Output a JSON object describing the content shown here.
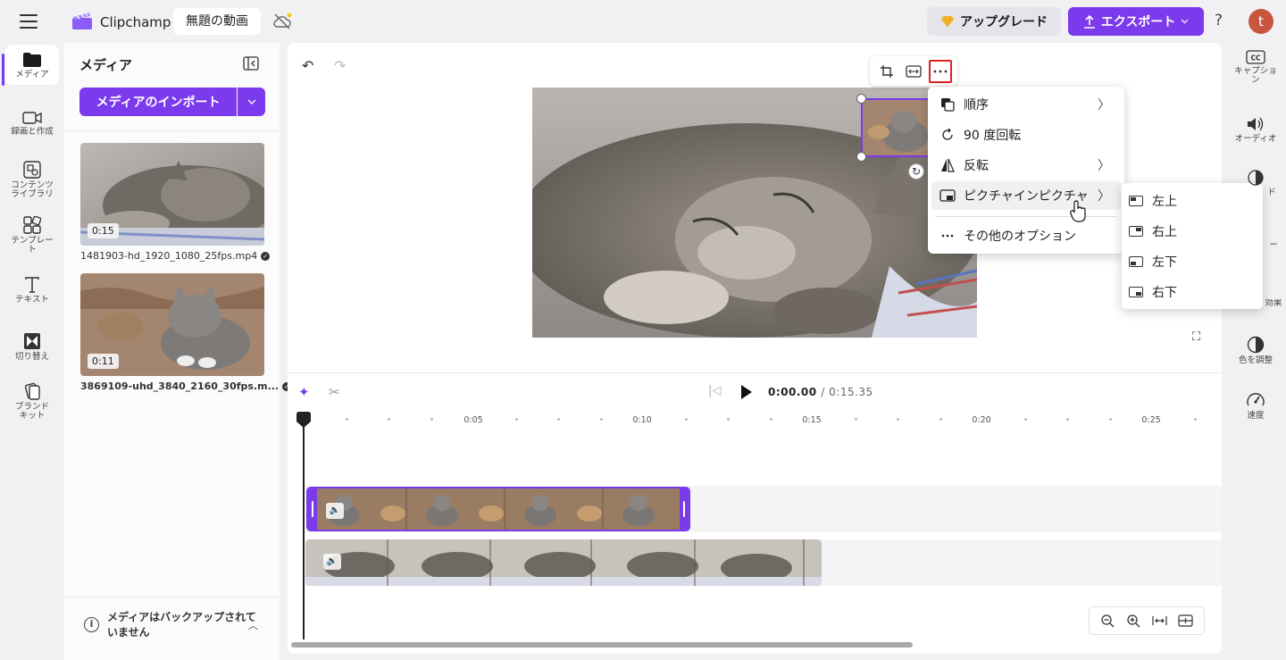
{
  "header": {
    "app_name": "Clipchamp",
    "project_title": "無題の動画",
    "upgrade_label": "アップグレード",
    "export_label": "エクスポート",
    "help_label": "?",
    "avatar_initial": "t"
  },
  "left_rail": {
    "items": [
      {
        "label": "メディア",
        "icon": "folder-icon"
      },
      {
        "label": "録画と作成",
        "icon": "video-camera-icon"
      },
      {
        "label": "コンテンツ ライブラリ",
        "icon": "library-icon"
      },
      {
        "label": "テンプレート",
        "icon": "template-icon"
      },
      {
        "label": "テキスト",
        "icon": "text-icon"
      },
      {
        "label": "切り替え",
        "icon": "transition-icon"
      },
      {
        "label": "ブランド キット",
        "icon": "brand-kit-icon"
      }
    ]
  },
  "media_panel": {
    "title": "メディア",
    "import_label": "メディアのインポート",
    "items": [
      {
        "duration": "0:15",
        "filename": "1481903-hd_1920_1080_25fps.mp4"
      },
      {
        "duration": "0:11",
        "filename": "3869109-uhd_3840_2160_30fps.m..."
      }
    ],
    "backup_notice": "メディアはバックアップされていません"
  },
  "context_menu": {
    "items": [
      {
        "label": "順序",
        "icon": "order-icon",
        "submenu": true
      },
      {
        "label": "90 度回転",
        "icon": "rotate-icon",
        "submenu": false
      },
      {
        "label": "反転",
        "icon": "flip-icon",
        "submenu": true
      },
      {
        "label": "ピクチャインピクチャ",
        "icon": "pip-icon",
        "submenu": true
      },
      {
        "label": "その他のオプション",
        "icon": "more-icon",
        "submenu": false
      }
    ],
    "pip_submenu": [
      "左上",
      "右上",
      "左下",
      "右下"
    ]
  },
  "timeline": {
    "current_time": "0:00.00",
    "total_time": "/ 0:15.35",
    "tick_labels": [
      "0:05",
      "0:10",
      "0:15",
      "0:20",
      "0:25"
    ]
  },
  "right_rail": {
    "items": [
      {
        "label": "キャプション",
        "icon": "captions-icon"
      },
      {
        "label": "オーディオ",
        "icon": "audio-icon"
      },
      {
        "label": "ド",
        "icon": "fade-icon"
      },
      {
        "label": "ー",
        "icon": "filter-icon"
      },
      {
        "label": "効果",
        "icon": "effects-icon"
      },
      {
        "label": "色を調整",
        "icon": "color-adjust-icon"
      },
      {
        "label": "速度",
        "icon": "speed-icon"
      }
    ]
  },
  "colors": {
    "accent": "#7c3aed",
    "highlight": "#e02020"
  }
}
